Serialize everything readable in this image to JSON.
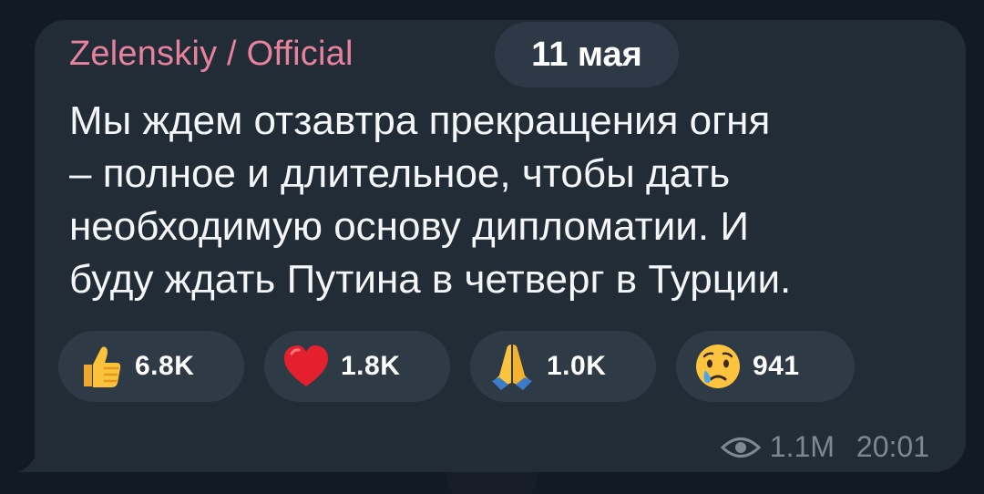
{
  "channel": {
    "sender_name": "Zelenskiy / Official",
    "date_badge": "11 мая"
  },
  "message": {
    "lines": [
      "Мы ждем отзавтра прекращения огня",
      "– полное и длительное, чтобы дать",
      "необходимую основу дипломатии. И",
      "буду ждать Путина в четверг в Турции."
    ]
  },
  "reactions": [
    {
      "icon": "thumbs-up-icon",
      "count": "6.8K"
    },
    {
      "icon": "red-heart-icon",
      "count": "1.8K"
    },
    {
      "icon": "folded-hands-icon",
      "count": "1.0K"
    },
    {
      "icon": "crying-face-icon",
      "count": "941"
    }
  ],
  "meta": {
    "views": "1.1M",
    "time": "20:01"
  },
  "colors": {
    "bubble": "#222c37",
    "sender": "#e7829c",
    "reaction_pill": "#2f3a47",
    "meta_text": "#7d8893"
  }
}
